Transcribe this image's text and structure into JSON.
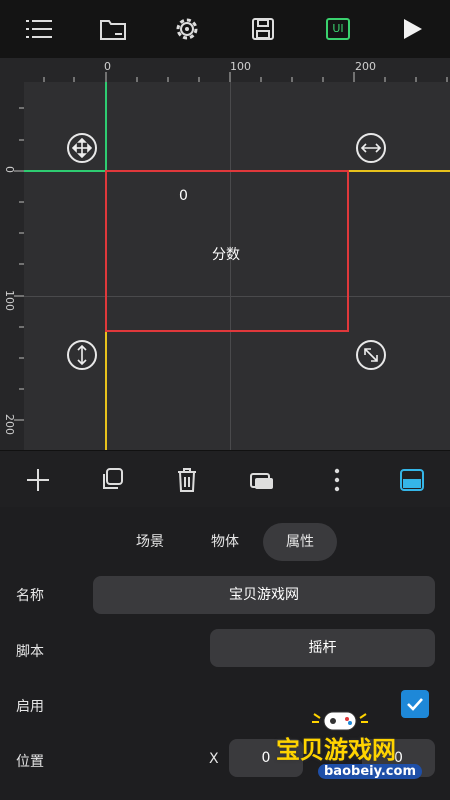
{
  "toolbar": {
    "icons": [
      "menu-icon",
      "folder-icon",
      "gear-icon",
      "save-icon",
      "ui-icon",
      "play-icon"
    ],
    "ui_label": "UI"
  },
  "canvas": {
    "ruler_top": [
      "0",
      "100",
      "200"
    ],
    "ruler_left": [
      "0",
      "100",
      "200"
    ],
    "object_value": "0",
    "object_name": "分数"
  },
  "bottom_toolbar": {
    "icons": [
      "add-icon",
      "duplicate-icon",
      "trash-icon",
      "layers-icon",
      "more-icon",
      "panel-toggle-icon"
    ]
  },
  "tabs": [
    {
      "label": "场景",
      "active": false
    },
    {
      "label": "物体",
      "active": false
    },
    {
      "label": "属性",
      "active": true
    }
  ],
  "properties": {
    "name_label": "名称",
    "name_value": "宝贝游戏网",
    "script_label": "脚本",
    "script_value": "摇杆",
    "enabled_label": "启用",
    "enabled": true,
    "position_label": "位置",
    "position_x_label": "X",
    "position_x_value": "0",
    "position_y_value": "0"
  },
  "watermark": {
    "text": "宝贝游戏网",
    "url": "baobeiy.com"
  },
  "colors": {
    "accent": "#1e88d8",
    "selection": "#e0383b",
    "axis_green": "#2ecc71",
    "axis_yellow": "#e8c21c",
    "ui_green": "#3ad16e"
  }
}
